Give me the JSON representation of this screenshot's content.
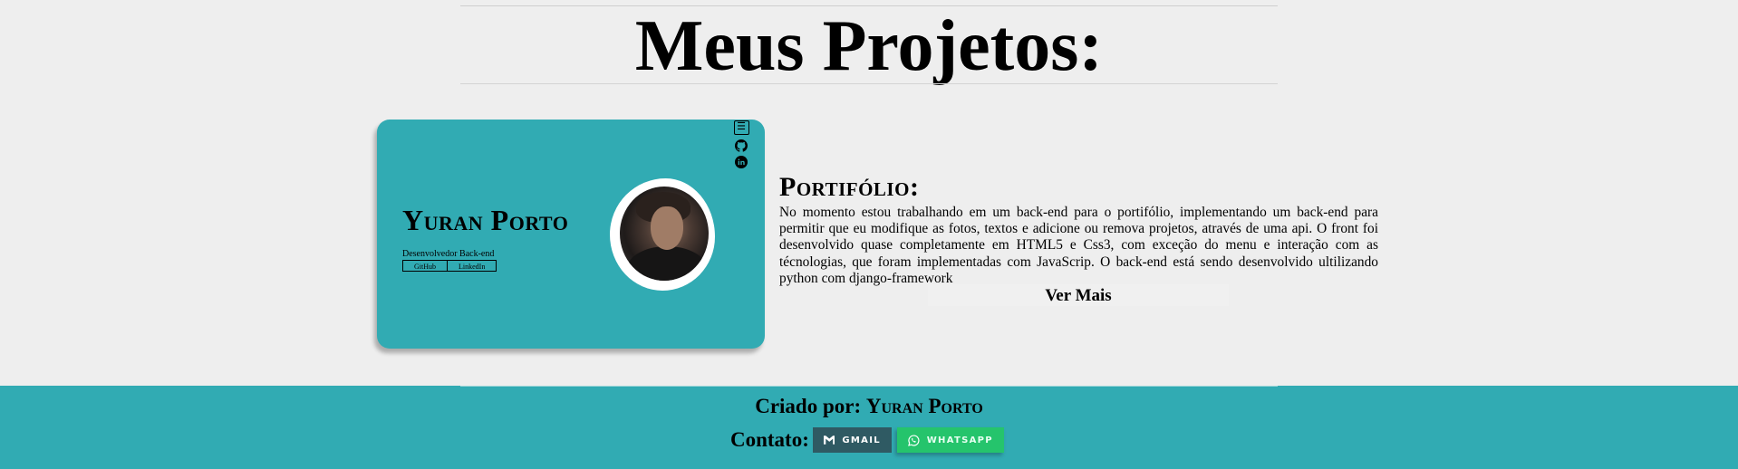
{
  "page": {
    "title": "Meus Projetos:"
  },
  "project_card": {
    "name": "Yuran Porto",
    "role": "Desenvolvedor Back-end",
    "links": [
      "GitHub",
      "LinkedIn"
    ],
    "icons": [
      "menu-icon",
      "github-icon",
      "linkedin-icon"
    ]
  },
  "project": {
    "title": "Portifólio:",
    "description": "No momento estou trabalhando em um back-end para o portifólio, implementando um back-end para permitir que eu modifique as fotos, textos e adicione ou remova projetos, através de uma api. O front foi desenvolvido quase completamente em HTML5 e Css3, com exceção do menu e interação com as técnologias, que foram implementadas com JavaScrip. O back-end está sendo desenvolvido ultilizando python com django-framework",
    "more_label": "Ver Mais"
  },
  "footer": {
    "credit_prefix": "Criado por:",
    "credit_name": "Yuran Porto",
    "contact_label": "Contato:",
    "gmail_label": "GMAIL",
    "whatsapp_label": "WHATSAPP"
  },
  "colors": {
    "teal": "#31abb3",
    "gmail": "#2f5a63",
    "whatsapp": "#25c46c"
  }
}
